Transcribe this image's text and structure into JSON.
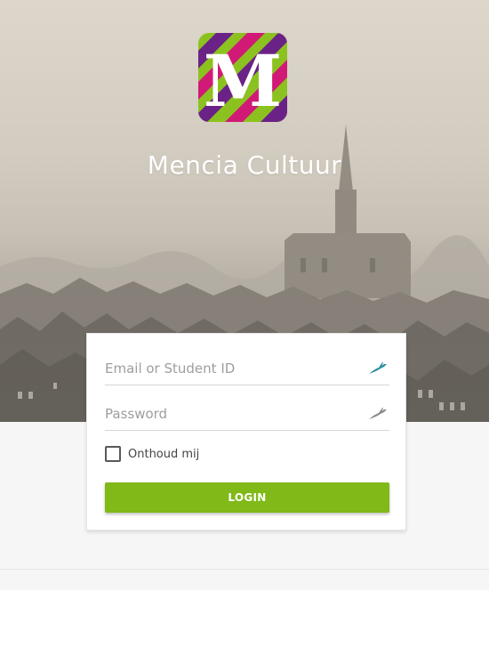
{
  "app": {
    "title": "Mencia Cultuur",
    "logo_letter": "M"
  },
  "login_form": {
    "email_placeholder": "Email or Student ID",
    "password_placeholder": "Password",
    "remember_label": "Onthoud mij",
    "remember_checked": false,
    "login_label": "LOGIN",
    "field_icon": "bird-icon"
  },
  "colors": {
    "brand_green": "#80b918",
    "logo_green": "#8cc21f",
    "logo_purple": "#6b2286",
    "logo_magenta": "#d01a76",
    "icon_teal": "#2a8fa0"
  }
}
